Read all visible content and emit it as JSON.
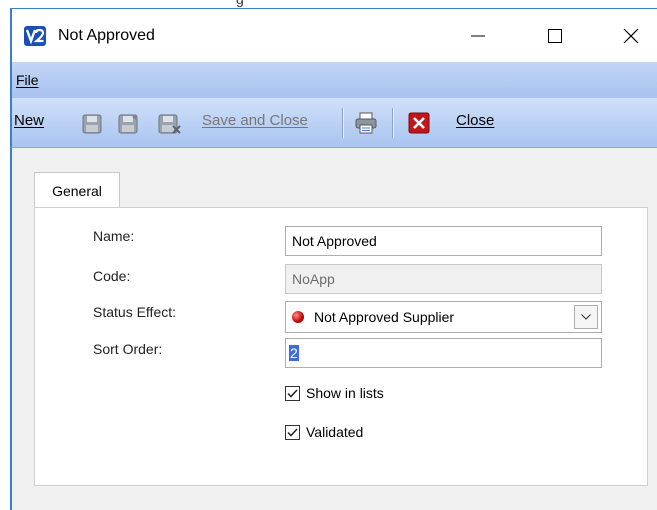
{
  "window": {
    "top_fragment": "g",
    "title": "Not Approved",
    "controls": {
      "minimize": "—",
      "maximize": "☐",
      "close": "✕"
    }
  },
  "menu": {
    "file": "File"
  },
  "toolbar": {
    "new": "New",
    "save_and_close": "Save and Close",
    "close": "Close"
  },
  "tabs": {
    "general": "General"
  },
  "form": {
    "name_label": "Name:",
    "name_value": "Not Approved",
    "code_label": "Code:",
    "code_value": "NoApp",
    "status_label": "Status Effect:",
    "status_value": "Not Approved Supplier",
    "sort_label": "Sort Order:",
    "sort_value": "2",
    "show_in_lists_label": "Show in lists",
    "show_in_lists_checked": true,
    "validated_label": "Validated",
    "validated_checked": true
  },
  "colors": {
    "title_border": "#3c7fc9",
    "menubar": "#b3cbf3",
    "selection": "#3a70d6",
    "status_dot": "#c40000",
    "close_icon": "#c0161b"
  }
}
